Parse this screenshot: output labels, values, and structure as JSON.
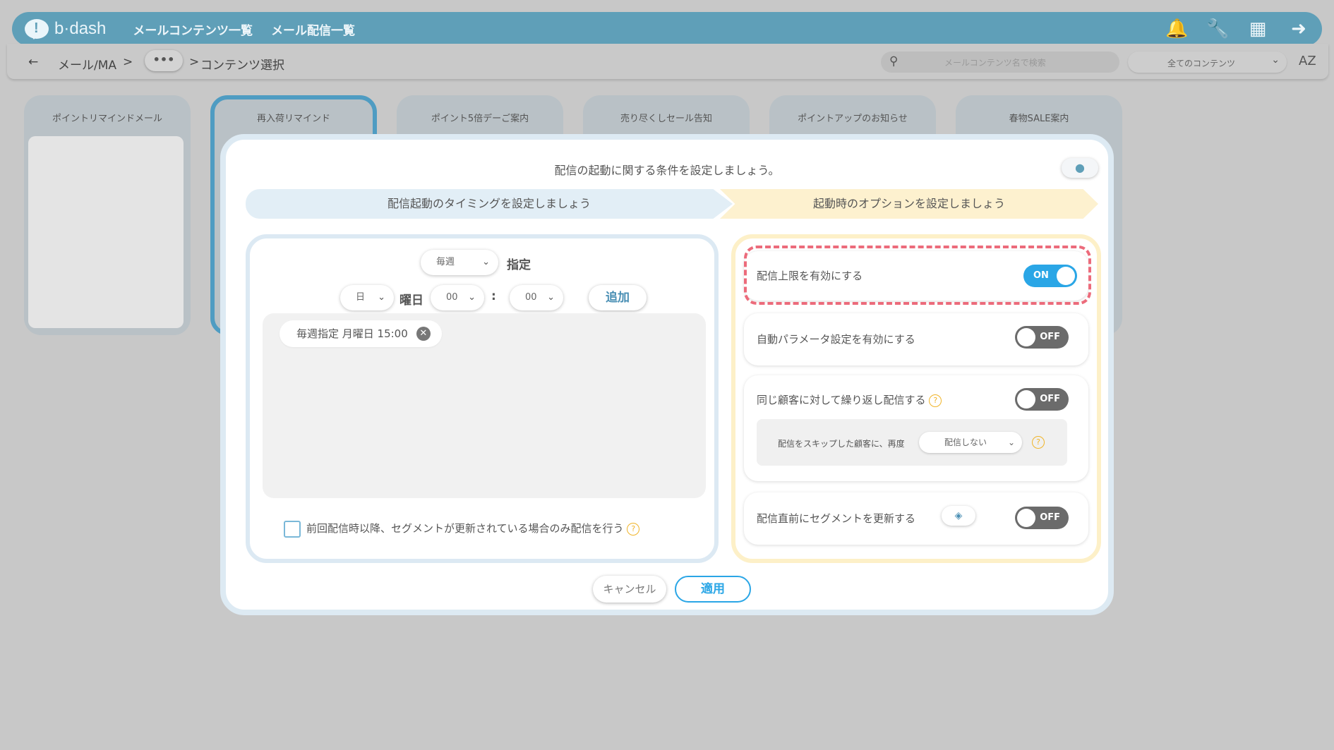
{
  "header": {
    "logo_text": "b·dash",
    "nav": [
      "メールコンテンツ一覧",
      "メール配信一覧"
    ]
  },
  "subbar": {
    "back_icon": "←",
    "crumb1": "メール/MA",
    "sep1": ">",
    "more": "•••",
    "sep2": ">",
    "crumb2": "コンテンツ選択",
    "search_placeholder": "メールコンテンツ名で検索",
    "filter_value": "全てのコンテンツ",
    "sort_label": "AZ"
  },
  "cards": [
    "ポイントリマインドメール",
    "再入荷リマインド",
    "ポイント5倍デーご案内",
    "売り尽くしセール告知",
    "ポイントアップのお知らせ",
    "春物SALE案内"
  ],
  "modal": {
    "title": "配信の起動に関する条件を設定しましょう。",
    "step1": "配信起動のタイミングを設定しましょう",
    "step2": "起動時のオプションを設定しましょう",
    "left": {
      "freq_value": "毎週",
      "freq_suffix": "指定",
      "day_value": "日",
      "day_label": "曜日",
      "hour_value": "00",
      "colon": ":",
      "minute_value": "00",
      "add_button": "追加",
      "tag": "毎週指定 月曜日 15:00",
      "checkbox_label": "前回配信時以降、セグメントが更新されている場合のみ配信を行う"
    },
    "options": [
      {
        "label": "配信上限を有効にする",
        "state": "ON"
      },
      {
        "label": "自動パラメータ設定を有効にする",
        "state": "OFF"
      },
      {
        "label": "同じ顧客に対して繰り返し配信する",
        "state": "OFF"
      },
      {
        "label": "配信直前にセグメントを更新する",
        "state": "OFF"
      }
    ],
    "skip_label": "配信をスキップした顧客に、再度",
    "skip_value": "配信しない",
    "cancel_button": "キャンセル",
    "apply_button": "適用"
  },
  "colors": {
    "header": "#5f9fb8",
    "accent": "#2aa6e6",
    "highlight": "#ec6b7b",
    "left_panel_border": "#dce9f3",
    "right_panel_border": "#fdf0c8"
  }
}
